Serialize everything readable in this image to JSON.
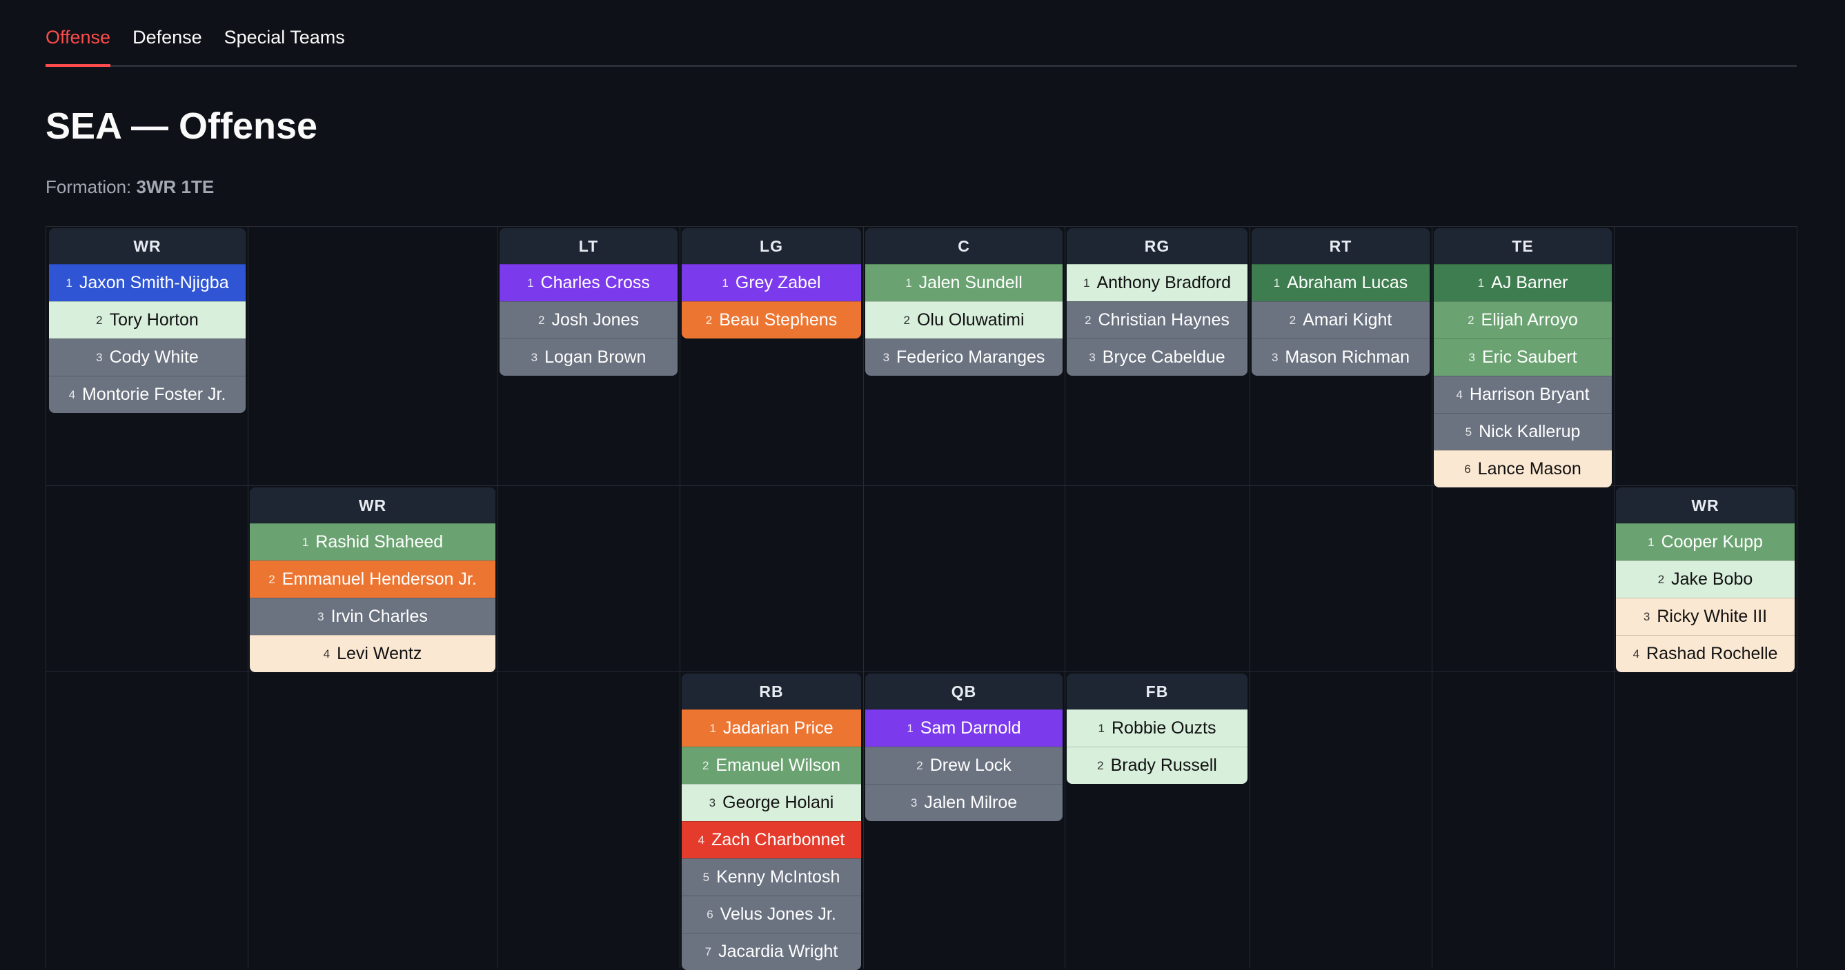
{
  "tabs": [
    {
      "label": "Offense",
      "active": true
    },
    {
      "label": "Defense",
      "active": false
    },
    {
      "label": "Special Teams",
      "active": false
    }
  ],
  "page": {
    "title": "SEA — Offense",
    "formation_label": "Formation:",
    "formation_value": "3WR 1TE"
  },
  "colors": {
    "gray": "#6b7280",
    "blue": "#2f55d4",
    "purple": "#7c3aed",
    "orange": "#ed7532",
    "green": "#6aa371",
    "dkgreen": "#3e7d4f",
    "mint": "#d8efdc",
    "cream": "#fbe8d2",
    "red": "#e53b2c",
    "tab_active": "#ff4b4b",
    "background": "#0e1117"
  },
  "positions": [
    {
      "id": "wr-left",
      "label": "WR",
      "players": [
        {
          "depth": "1",
          "name": "Jaxon Smith-Njigba",
          "color": "blue"
        },
        {
          "depth": "2",
          "name": "Tory Horton",
          "color": "mint"
        },
        {
          "depth": "3",
          "name": "Cody White",
          "color": "gray"
        },
        {
          "depth": "4",
          "name": "Montorie Foster Jr.",
          "color": "gray"
        }
      ]
    },
    {
      "id": "lt",
      "label": "LT",
      "players": [
        {
          "depth": "1",
          "name": "Charles Cross",
          "color": "purple"
        },
        {
          "depth": "2",
          "name": "Josh Jones",
          "color": "gray"
        },
        {
          "depth": "3",
          "name": "Logan Brown",
          "color": "gray"
        }
      ]
    },
    {
      "id": "lg",
      "label": "LG",
      "players": [
        {
          "depth": "1",
          "name": "Grey Zabel",
          "color": "purple"
        },
        {
          "depth": "2",
          "name": "Beau Stephens",
          "color": "orange"
        }
      ]
    },
    {
      "id": "c",
      "label": "C",
      "players": [
        {
          "depth": "1",
          "name": "Jalen Sundell",
          "color": "green"
        },
        {
          "depth": "2",
          "name": "Olu Oluwatimi",
          "color": "mint"
        },
        {
          "depth": "3",
          "name": "Federico Maranges",
          "color": "gray"
        }
      ]
    },
    {
      "id": "rg",
      "label": "RG",
      "players": [
        {
          "depth": "1",
          "name": "Anthony Bradford",
          "color": "mint"
        },
        {
          "depth": "2",
          "name": "Christian Haynes",
          "color": "gray"
        },
        {
          "depth": "3",
          "name": "Bryce Cabeldue",
          "color": "gray"
        }
      ]
    },
    {
      "id": "rt",
      "label": "RT",
      "players": [
        {
          "depth": "1",
          "name": "Abraham Lucas",
          "color": "dkgreen"
        },
        {
          "depth": "2",
          "name": "Amari Kight",
          "color": "gray"
        },
        {
          "depth": "3",
          "name": "Mason Richman",
          "color": "gray"
        }
      ]
    },
    {
      "id": "te",
      "label": "TE",
      "players": [
        {
          "depth": "1",
          "name": "AJ Barner",
          "color": "dkgreen"
        },
        {
          "depth": "2",
          "name": "Elijah Arroyo",
          "color": "green"
        },
        {
          "depth": "3",
          "name": "Eric Saubert",
          "color": "green"
        },
        {
          "depth": "4",
          "name": "Harrison Bryant",
          "color": "gray"
        },
        {
          "depth": "5",
          "name": "Nick Kallerup",
          "color": "gray"
        },
        {
          "depth": "6",
          "name": "Lance Mason",
          "color": "cream"
        }
      ]
    },
    {
      "id": "wr-slot",
      "label": "WR",
      "players": [
        {
          "depth": "1",
          "name": "Rashid Shaheed",
          "color": "green"
        },
        {
          "depth": "2",
          "name": "Emmanuel Henderson Jr.",
          "color": "orange"
        },
        {
          "depth": "3",
          "name": "Irvin Charles",
          "color": "gray"
        },
        {
          "depth": "4",
          "name": "Levi Wentz",
          "color": "cream"
        }
      ]
    },
    {
      "id": "wr-right",
      "label": "WR",
      "players": [
        {
          "depth": "1",
          "name": "Cooper Kupp",
          "color": "green"
        },
        {
          "depth": "2",
          "name": "Jake Bobo",
          "color": "mint"
        },
        {
          "depth": "3",
          "name": "Ricky White III",
          "color": "cream"
        },
        {
          "depth": "4",
          "name": "Rashad Rochelle",
          "color": "cream"
        }
      ]
    },
    {
      "id": "rb",
      "label": "RB",
      "players": [
        {
          "depth": "1",
          "name": "Jadarian Price",
          "color": "orange"
        },
        {
          "depth": "2",
          "name": "Emanuel Wilson",
          "color": "green"
        },
        {
          "depth": "3",
          "name": "George Holani",
          "color": "mint"
        },
        {
          "depth": "4",
          "name": "Zach Charbonnet",
          "color": "red"
        },
        {
          "depth": "5",
          "name": "Kenny McIntosh",
          "color": "gray"
        },
        {
          "depth": "6",
          "name": "Velus Jones Jr.",
          "color": "gray"
        },
        {
          "depth": "7",
          "name": "Jacardia Wright",
          "color": "gray"
        }
      ]
    },
    {
      "id": "qb",
      "label": "QB",
      "players": [
        {
          "depth": "1",
          "name": "Sam Darnold",
          "color": "purple"
        },
        {
          "depth": "2",
          "name": "Drew Lock",
          "color": "gray"
        },
        {
          "depth": "3",
          "name": "Jalen Milroe",
          "color": "gray"
        }
      ]
    },
    {
      "id": "fb",
      "label": "FB",
      "players": [
        {
          "depth": "1",
          "name": "Robbie Ouzts",
          "color": "mint"
        },
        {
          "depth": "2",
          "name": "Brady Russell",
          "color": "mint"
        }
      ]
    }
  ]
}
